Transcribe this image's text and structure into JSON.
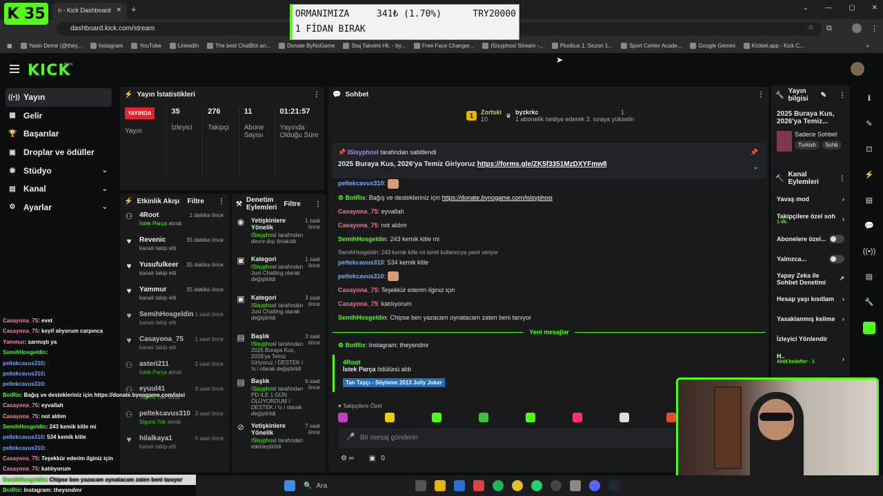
{
  "browser": {
    "tab_title": "n - Kick Dashboard",
    "url": "dashboard.kick.com/stream",
    "bookmarks": [
      "Yasin Demir (@they...",
      "Instagram",
      "YouTube",
      "LinkedIn",
      "The best ChatBot an...",
      "Donate ByNoGame",
      "Staj Takvimi Hk. - by...",
      "Free Face Changer...",
      "ISisyphosI Stream -...",
      "Pluribus 1. Sezon 1...",
      "Sport Center Acade...",
      "Google Gemini",
      "Kicklet.app - Kick C..."
    ]
  },
  "overlay": {
    "badge": "K 35",
    "donation_line1": "ORMANIMIZA",
    "donation_amount": "341₺ (1.70%)",
    "donation_total": "TRY20000",
    "donation_line2": "1 FİDAN BIRAK"
  },
  "app": {
    "logo": "KICK",
    "beta": "BETA"
  },
  "nav": [
    {
      "icon": "((•))",
      "label": "Yayın"
    },
    {
      "icon": "▦",
      "label": "Gelir"
    },
    {
      "icon": "🏆",
      "label": "Başarılar"
    },
    {
      "icon": "▣",
      "label": "Droplar ve ödüller"
    },
    {
      "icon": "◉",
      "label": "Stüdyo"
    },
    {
      "icon": "▤",
      "label": "Kanal"
    },
    {
      "icon": "⚙",
      "label": "Ayarlar"
    }
  ],
  "stats": {
    "title": "Yayın İstatistikleri",
    "live": "YAYINDA",
    "items": [
      {
        "value": "35",
        "label": "İzleyici"
      },
      {
        "value": "276",
        "label": "Takipçi"
      },
      {
        "value": "11",
        "label": "Abone Sayısı"
      },
      {
        "value": "01:21:57",
        "label": "Yayında Olduğu Süre"
      }
    ],
    "yayin_label": "Yayın"
  },
  "activity": {
    "title": "Etkinlik Akışı",
    "filter": "Filtre",
    "items": [
      {
        "name": "4Root",
        "sub_green": "İstek Parça",
        "sub": "alındı",
        "time": "1 dakika önce"
      },
      {
        "name": "Revenic",
        "sub_green": "",
        "sub": "kanalı takip etti",
        "time": "35 dakika önce"
      },
      {
        "name": "Yusufulkeer",
        "sub_green": "",
        "sub": "kanalı takip etti",
        "time": "35 dakika önce"
      },
      {
        "name": "Yammur",
        "sub_green": "",
        "sub": "kanalı takip etti",
        "time": "35 dakika önce"
      },
      {
        "name": "SemihHosgeldin",
        "sub_green": "",
        "sub": "kanalı takip etti",
        "time": "1 saat önce"
      },
      {
        "name": "Casayona_75",
        "sub_green": "",
        "sub": "kanalı takip etti",
        "time": "1 saat önce"
      },
      {
        "name": "asteri211",
        "sub_green": "İstek Parça",
        "sub": "alındı",
        "time": "2 saat önce"
      },
      {
        "name": "eyuul41",
        "sub_green": "Sigara Yak",
        "sub": "alındı",
        "time": "3 saat önce"
      },
      {
        "name": "peltekcavus310",
        "sub_green": "Sigara Yak",
        "sub": "alındı",
        "time": "3 saat önce"
      },
      {
        "name": "hilalkaya1",
        "sub_green": "",
        "sub": "kanalı takip etti",
        "time": "5 saat önce"
      }
    ]
  },
  "moderation": {
    "title": "Denetim Eylemleri",
    "filter": "Filtre",
    "items": [
      {
        "title": "Yetişkinlere Yönelik",
        "by": "ISisyphosI",
        "sub": "tarafından devre dışı bırakıldı",
        "time": "1 saat önce"
      },
      {
        "title": "Kategori",
        "by": "ISisyphosI",
        "sub": "tarafından Just Chatting olarak değiştirildi",
        "time": "1 saat önce"
      },
      {
        "title": "Kategori",
        "by": "ISisyphosI",
        "sub": "tarafından Just Chatting olarak değiştirildi",
        "time": "3 saat önce"
      },
      {
        "title": "Başlık",
        "by": "ISisyphosI",
        "sub": "tarafından 2025 Buraya Kus, 2026'ya Temiz Giriyoruz / DESTEK / !s / olarak değiştirildi",
        "time": "3 saat önce"
      },
      {
        "title": "Başlık",
        "by": "ISisyphosI",
        "sub": "tarafından PD ILE 1 GÜN ÖLÜYORDUM / DESTEK / !s / olarak değiştirildi",
        "time": "6 saat önce"
      },
      {
        "title": "Yetişkinlere Yönelik",
        "by": "ISisyphosI",
        "sub": "tarafından etkinleştirildi",
        "time": "7 saat önce"
      }
    ]
  },
  "chat": {
    "title": "Sohbet",
    "gift_user": "Zortski",
    "gift_count": "10",
    "gift_target": "byzkrkc",
    "gift_text": "1 abonelik hediye ederek 3. sıraya yükselin",
    "gift_rank": "1",
    "pinned_by": "ISisyphosI",
    "pinned_by_suffix": "tarafından sabitlendi",
    "pinned_text": "2025 Buraya Kus, 2026'ya Temiz Giriyoruz",
    "pinned_link": "https://forms.gle/ZK5f3351MzDXYFmw8",
    "messages": [
      {
        "user": "peltekcavus310",
        "color": "blue",
        "text": "",
        "emote": true
      },
      {
        "user": "BotRix",
        "color": "green",
        "text": "Bağış ve destekleriniz için",
        "link": "https://donate.bynogame.com/isisyphosi"
      },
      {
        "user": "Casayona_75",
        "color": "pink",
        "text": "eyvallah"
      },
      {
        "user": "Casayona_75",
        "color": "pink",
        "text": "not aldım"
      },
      {
        "user": "SemihHosgeldin",
        "color": "green",
        "text": "243 kemik kitle mi"
      },
      {
        "reply": "SemihHosgeldin: 243 kemik kitle mi isimli kullanıcıya yanıt veriyor",
        "user": "peltekcavus310",
        "color": "blue",
        "text": "534 kemik kitle"
      },
      {
        "user": "peltekcavus310",
        "color": "blue",
        "text": "",
        "emote": true
      },
      {
        "user": "Casayona_75",
        "color": "pink",
        "text": "Teşekkür ederim ilginiz için"
      },
      {
        "user": "Casayona_75",
        "color": "pink",
        "text": "katılıyorum"
      },
      {
        "user": "SemihHosgeldin",
        "color": "green",
        "text": "Chipse ben yazacam oynatacam zaten beni tanıyor"
      }
    ],
    "new_messages": "Yeni mesajlar",
    "botrix_last": "Instagram: theysndmr",
    "reward_user": "4Root",
    "reward_item": "İstek Parça",
    "reward_suffix": "ödülünü aldı",
    "reward_song": "Tan Taşçı - Söyleme 2013 Jolly Joker",
    "followers_only": "Takipçilere Özel",
    "input_placeholder": "Bir mesaj gönderin",
    "footer_count": "0"
  },
  "stream_info": {
    "title": "Yayın bilgisi",
    "stream_title": "2025 Buraya Kus, 2026'ya Temiz...",
    "category": "Sadece Sohbet",
    "tags": [
      "Turkish",
      "Sohb"
    ]
  },
  "channel_actions": {
    "title": "Kanal Eylemleri",
    "items": [
      {
        "label": "Yavaş mod",
        "type": "chev"
      },
      {
        "label": "Takipçilere özel soh",
        "sub": "1 dk.",
        "type": "chev"
      },
      {
        "label": "Abonelere özel...",
        "type": "toggle"
      },
      {
        "label": "Yalnızca...",
        "type": "toggle"
      },
      {
        "label": "Yapay Zeka ile Sohbet Denetimi",
        "type": "ext"
      },
      {
        "label": "Hesap yaşı kısıtlam",
        "type": "chev"
      },
      {
        "label": "Yasaklanmış kelime",
        "type": "chev"
      },
      {
        "label": "İzleyici Yönlendir",
        "type": "none"
      },
      {
        "label": "H..",
        "sub": "Aktif hedefler - 1",
        "type": "chev"
      }
    ]
  },
  "overlay_chat": [
    {
      "u": "Casayona_75",
      "c": "pink",
      "t": ": evet"
    },
    {
      "u": "Casayona_75",
      "c": "pink",
      "t": ": keyif alıyorum carpınca"
    },
    {
      "u": "Yammur",
      "c": "pink",
      "t": ": sarmıştı ya"
    },
    {
      "u": "SemihHosgeldin",
      "c": "green",
      "t": ":"
    },
    {
      "u": "peltekcavus310",
      "c": "blue",
      "t": ":"
    },
    {
      "u": "peltekcavus310",
      "c": "blue",
      "t": ":"
    },
    {
      "u": "peltekcavus310",
      "c": "blue",
      "t": ":"
    },
    {
      "u": "BotRix",
      "c": "green",
      "t": ": Bağış ve destekleriniz için https://donate.bynogame.com/isisi"
    },
    {
      "u": "Casayona_75",
      "c": "pink",
      "t": ": eyvallah"
    },
    {
      "u": "Casayona_75",
      "c": "pink",
      "t": ": not aldım"
    },
    {
      "u": "SemihHosgeldin",
      "c": "green",
      "t": ": 243 kemik kitle mi"
    },
    {
      "u": "peltekcavus310",
      "c": "blue",
      "t": ": 534 kemik kitle"
    },
    {
      "u": "peltekcavus310",
      "c": "blue",
      "t": ":"
    },
    {
      "u": "Casayona_75",
      "c": "pink",
      "t": ": Teşekkür ederim ilginiz için"
    },
    {
      "u": "Casayona_75",
      "c": "pink",
      "t": ": katılıyorum"
    },
    {
      "u": "SemihHosgeldin",
      "c": "green",
      "t": ": Chipse ben yazacam oynatacam zaten beni tanıyor"
    },
    {
      "u": "BotRix",
      "c": "green",
      "t": ": Instagram: theysndmr"
    }
  ],
  "taskbar": {
    "search": "Ara"
  }
}
